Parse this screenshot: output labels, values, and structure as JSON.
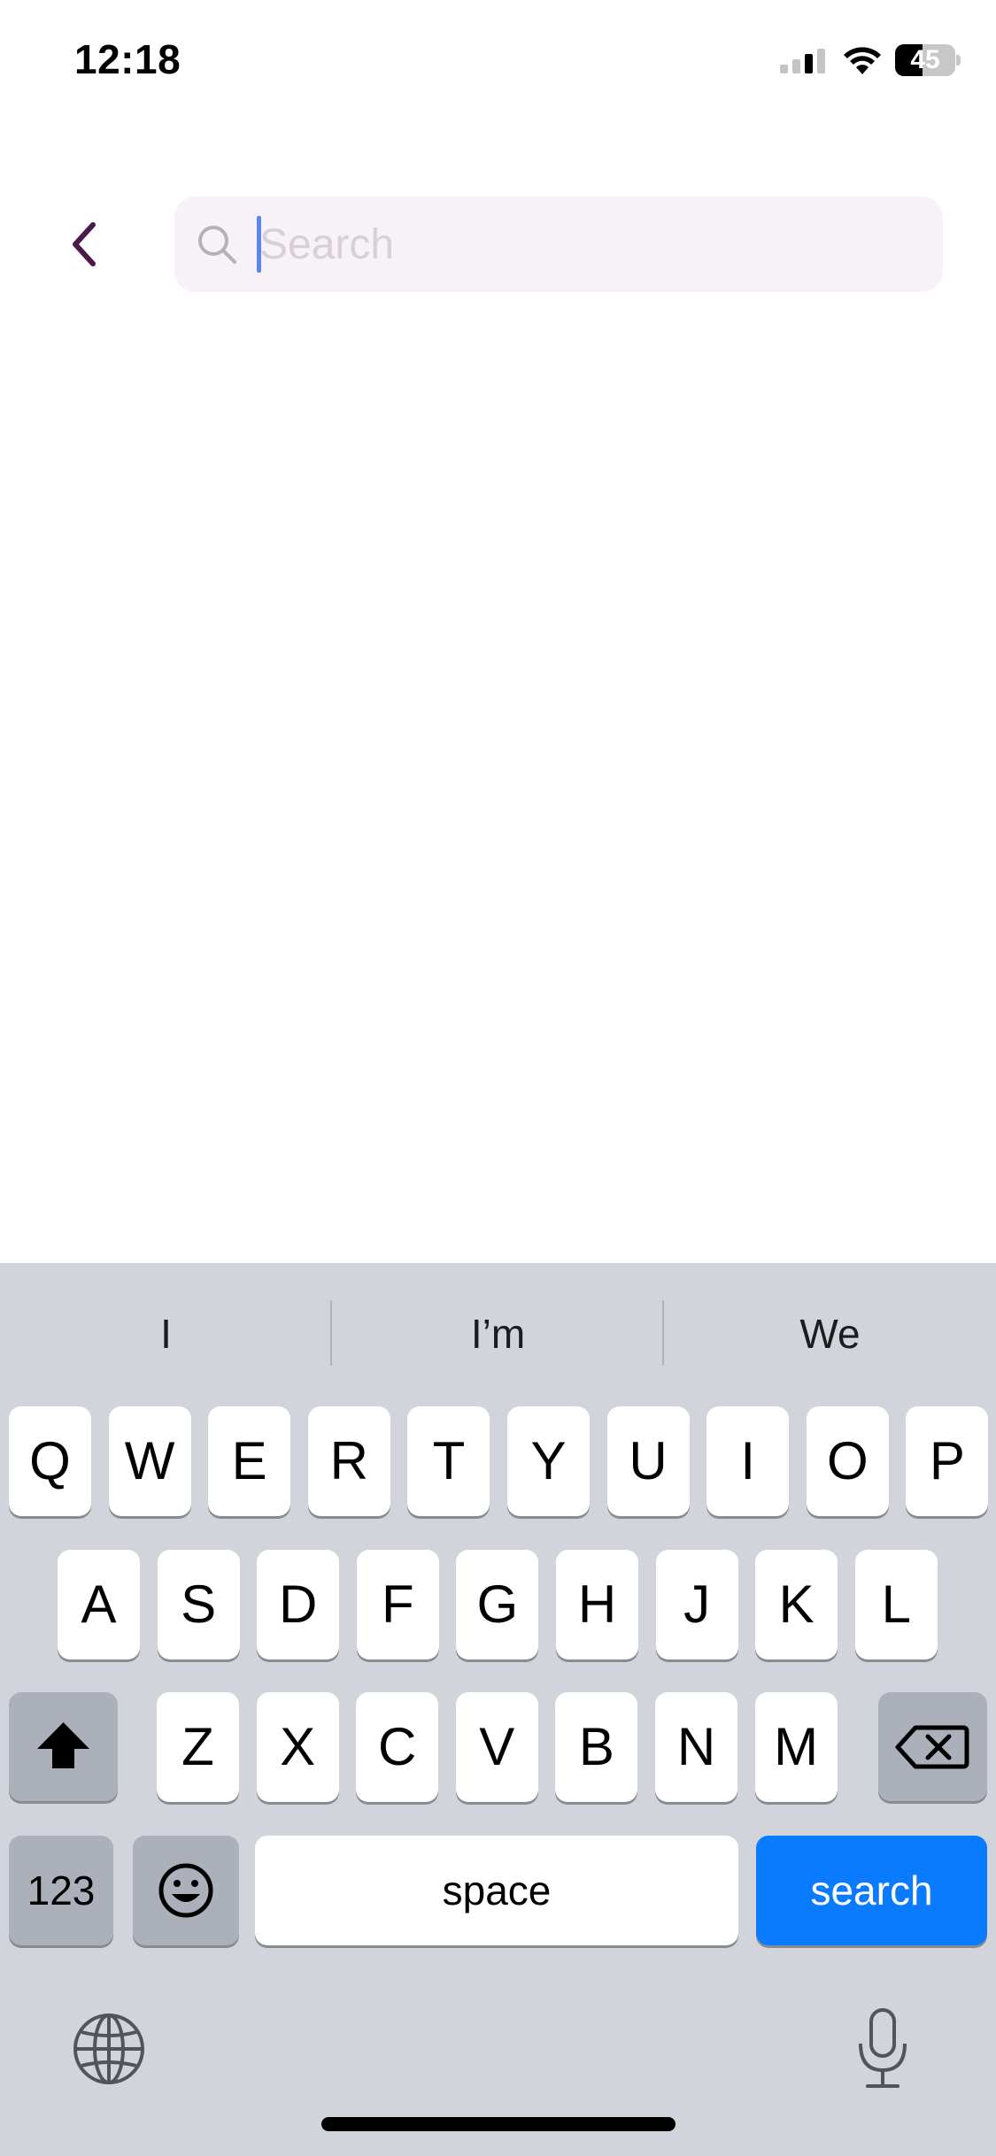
{
  "status_bar": {
    "time": "12:18",
    "battery_level": "45",
    "battery_fraction": 0.45
  },
  "header": {
    "back_icon": "chevron-left-icon",
    "search": {
      "placeholder": "Search",
      "value": ""
    }
  },
  "keyboard": {
    "suggestions": [
      "I",
      "I’m",
      "We"
    ],
    "row1": [
      "Q",
      "W",
      "E",
      "R",
      "T",
      "Y",
      "U",
      "I",
      "O",
      "P"
    ],
    "row2": [
      "A",
      "S",
      "D",
      "F",
      "G",
      "H",
      "J",
      "K",
      "L"
    ],
    "row3": [
      "Z",
      "X",
      "C",
      "V",
      "B",
      "N",
      "M"
    ],
    "numbers_label": "123",
    "space_label": "space",
    "search_label": "search",
    "shift_icon": "shift-icon",
    "delete_icon": "delete-icon",
    "emoji_icon": "emoji-icon",
    "globe_icon": "globe-icon",
    "mic_icon": "microphone-icon",
    "search_key_color": "#0a7aff"
  },
  "colors": {
    "accent": "#4a1a4a",
    "search_bg": "#f7f2f7",
    "keyboard_bg": "#d1d4da"
  }
}
